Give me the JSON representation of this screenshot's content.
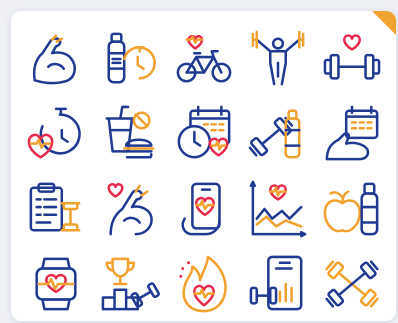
{
  "colors": {
    "primary_stroke": "#1f3a93",
    "accent_orange": "#f2a12e",
    "accent_red": "#e8294c",
    "background": "#eef0f5",
    "card": "#ffffff",
    "corner_tab": "#f0a331"
  },
  "icons": [
    {
      "row": 1,
      "name": "flexed-arm-icon"
    },
    {
      "row": 1,
      "name": "water-bottle-stopwatch-icon"
    },
    {
      "row": 1,
      "name": "bicycle-heart-icon"
    },
    {
      "row": 1,
      "name": "weightlifter-icon"
    },
    {
      "row": 1,
      "name": "dumbbell-heart-icon"
    },
    {
      "row": 2,
      "name": "heart-rate-stopwatch-icon"
    },
    {
      "row": 2,
      "name": "fast-food-icon"
    },
    {
      "row": 2,
      "name": "calendar-clock-heart-icon"
    },
    {
      "row": 2,
      "name": "dumbbell-bottle-icon"
    },
    {
      "row": 2,
      "name": "arm-calendar-icon"
    },
    {
      "row": 3,
      "name": "clipboard-dumbbell-icon"
    },
    {
      "row": 3,
      "name": "arm-heart-icon"
    },
    {
      "row": 3,
      "name": "smartphone-heart-icon"
    },
    {
      "row": 3,
      "name": "heart-rate-chart-icon"
    },
    {
      "row": 3,
      "name": "apple-bottle-icon"
    },
    {
      "row": 4,
      "name": "smartwatch-heart-icon"
    },
    {
      "row": 4,
      "name": "trophy-podium-icon"
    },
    {
      "row": 4,
      "name": "flame-heart-icon"
    },
    {
      "row": 4,
      "name": "phone-dumbbell-stats-icon"
    },
    {
      "row": 4,
      "name": "crossed-dumbbells-icon"
    }
  ]
}
